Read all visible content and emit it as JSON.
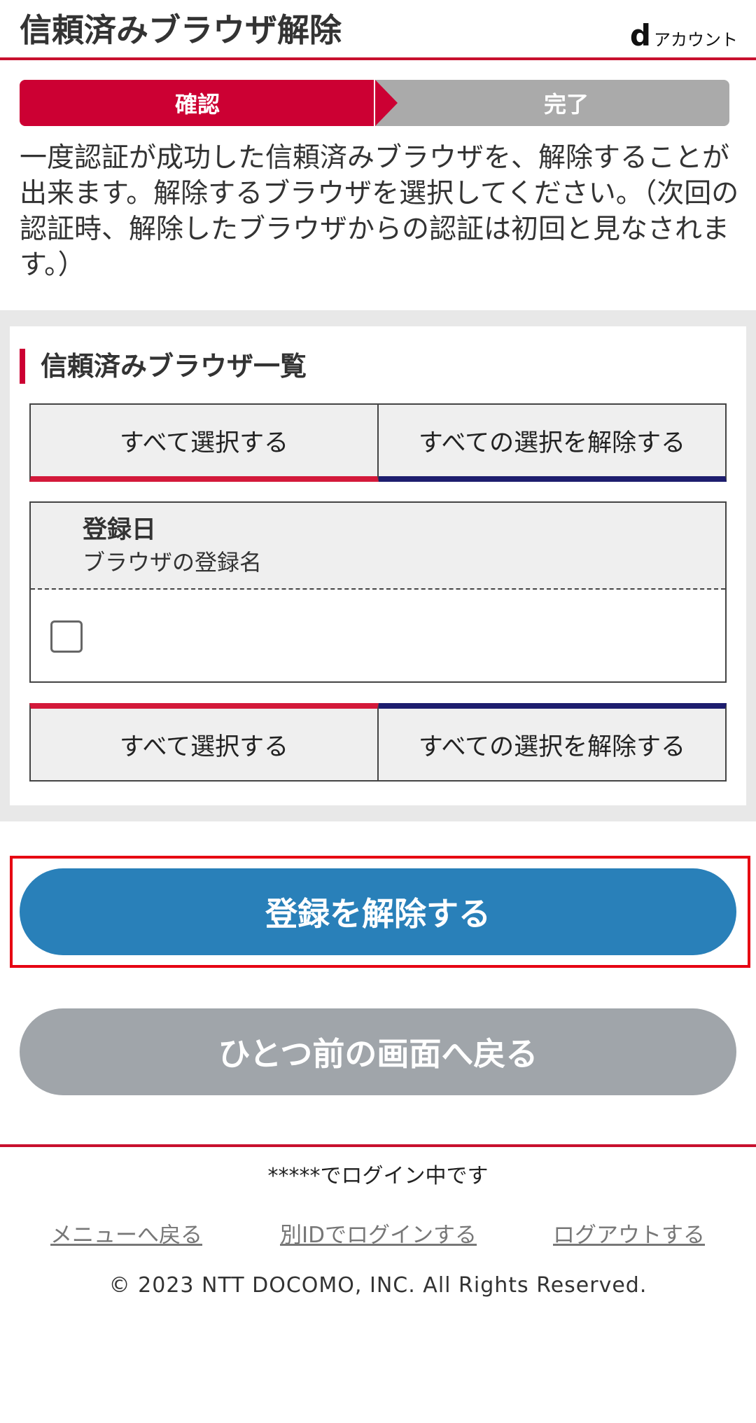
{
  "header": {
    "title": "信頼済みブラウザ解除",
    "logo_mark": "d",
    "logo_text": "アカウント"
  },
  "steps": [
    {
      "label": "確認",
      "state": "active"
    },
    {
      "label": "完了",
      "state": "inactive"
    }
  ],
  "description": "一度認証が成功した信頼済みブラウザを、解除することが出来ます。解除するブラウザを選択してください。（次回の認証時、解除したブラウザからの認証は初回と見なされます。）",
  "browser_list": {
    "title": "信頼済みブラウザ一覧",
    "select_all_label": "すべて選択する",
    "deselect_all_label": "すべての選択を解除する",
    "column_date": "登録日",
    "column_name": "ブラウザの登録名",
    "rows": [
      {
        "checked": false,
        "date": "",
        "name": ""
      }
    ]
  },
  "actions": {
    "release_label": "登録を解除する",
    "back_label": "ひとつ前の画面へ戻る"
  },
  "footer": {
    "login_status": "*****でログイン中です",
    "links": [
      "メニューへ戻る",
      "別IDでログインする",
      "ログアウトする"
    ],
    "copyright": "© 2023 NTT DOCOMO, INC. All Rights Reserved."
  },
  "colors": {
    "brand_red": "#cc0033",
    "primary_blue": "#2980b9",
    "secondary_gray": "#a0a5aa",
    "deselect_navy": "#1d1d6e"
  }
}
